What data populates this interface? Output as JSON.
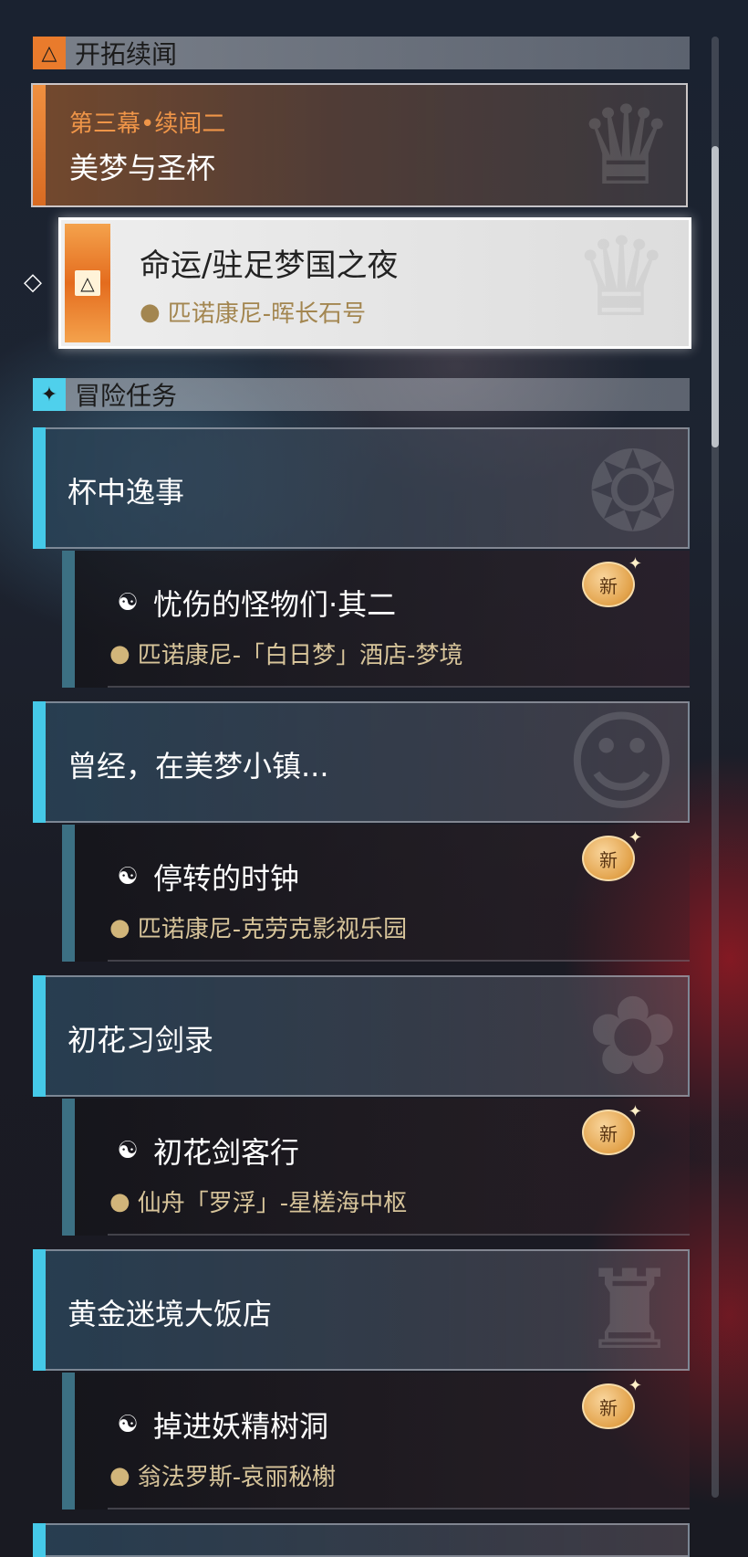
{
  "trailblaze": {
    "header": "开拓续闻",
    "story": {
      "subtitle": "第三幕•续闻二",
      "title": "美梦与圣杯"
    },
    "active_quest": {
      "title": "命运/驻足梦国之夜",
      "location": "匹诺康尼-晖长石号"
    }
  },
  "adventure": {
    "header": "冒险任务",
    "events": [
      {
        "name": "杯中逸事",
        "quest": {
          "title": "忧伤的怪物们·其二",
          "location": "匹诺康尼-「白日梦」酒店-梦境",
          "badge": "新"
        }
      },
      {
        "name": "曾经，在美梦小镇...",
        "quest": {
          "title": "停转的时钟",
          "location": "匹诺康尼-克劳克影视乐园",
          "badge": "新"
        }
      },
      {
        "name": "初花习剑录",
        "quest": {
          "title": "初花剑客行",
          "location": "仙舟「罗浮」-星槎海中枢",
          "badge": "新"
        }
      },
      {
        "name": "黄金迷境大饭店",
        "quest": {
          "title": "掉进妖精树洞",
          "location": "翁法罗斯-哀丽秘榭",
          "badge": "新"
        }
      }
    ]
  },
  "icons": {
    "trailblaze": "triangle-icon",
    "adventure": "sparkle-icon",
    "quest": "quest-type-icon",
    "pin": "location-pin-icon",
    "track": "diamond-pointer-icon"
  },
  "colors": {
    "orange": "#e97b2c",
    "cyan": "#45c9e8",
    "gold": "#d1b57a"
  }
}
